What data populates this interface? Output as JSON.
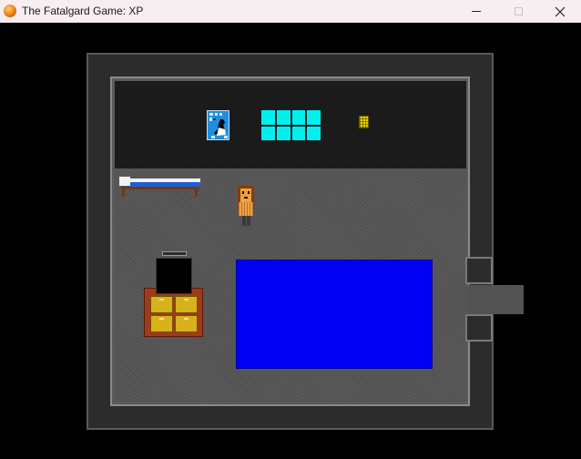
{
  "window": {
    "title": "The Fatalgard Game: XP",
    "icon": "app-orb-icon"
  },
  "controls": {
    "minimize_icon": "minimize-icon",
    "maximize_icon": "maximize-icon",
    "close_icon": "close-icon"
  },
  "scene": {
    "room": "bedroom",
    "objects": [
      "poster",
      "window",
      "wall-clock",
      "bed",
      "player",
      "tv",
      "cabinet",
      "rug",
      "doorway"
    ],
    "colors": {
      "background": "#000000",
      "outer_wall": "#2c2c2c",
      "back_wall": "#1b1b1b",
      "floor": "#565656",
      "window_pane": "#00f0f0",
      "poster": "#1e8fe0",
      "rug": "#0000f4",
      "bed_blanket": "#1f5fd6",
      "cabinet": "#a13a1a",
      "drawer": "#d8b21c",
      "player_hair": "#8a3c0a",
      "player_skin": "#f0a040"
    }
  }
}
